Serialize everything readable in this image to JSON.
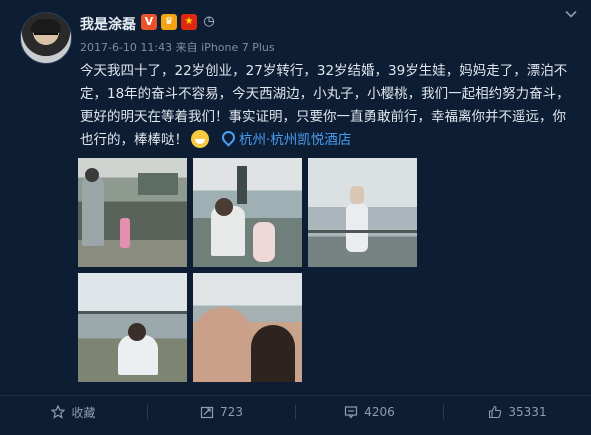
{
  "post": {
    "author": "我是涂磊",
    "timestamp": "2017-6-10 11:43",
    "source_prefix": "来自",
    "source": "iPhone 7 Plus",
    "text": "今天我四十了，22岁创业，27岁转行，32岁结婚，39岁生娃，妈妈走了，漂泊不定，18年的奋斗不容易，今天西湖边，小丸子，小樱桃，我们一起相约努力奋斗，更好的明天在等着我们！事实证明，只要你一直勇敢前行，幸福离你并不遥远，你也行的，棒棒哒！",
    "location": "杭州·杭州凯悦酒店",
    "badges": [
      "V",
      "♛",
      "★",
      "◷"
    ]
  },
  "actions": {
    "favorite_label": "收藏",
    "repost_count": "723",
    "comment_count": "4206",
    "like_count": "35331"
  },
  "colors": {
    "background": "#0d1d33",
    "link": "#4a9ff0",
    "text": "#dfe6ee",
    "muted": "#7d8da3"
  },
  "icons": [
    "chevron-down-icon",
    "location-pin-icon",
    "star-icon",
    "repost-icon",
    "comment-icon",
    "like-icon"
  ]
}
